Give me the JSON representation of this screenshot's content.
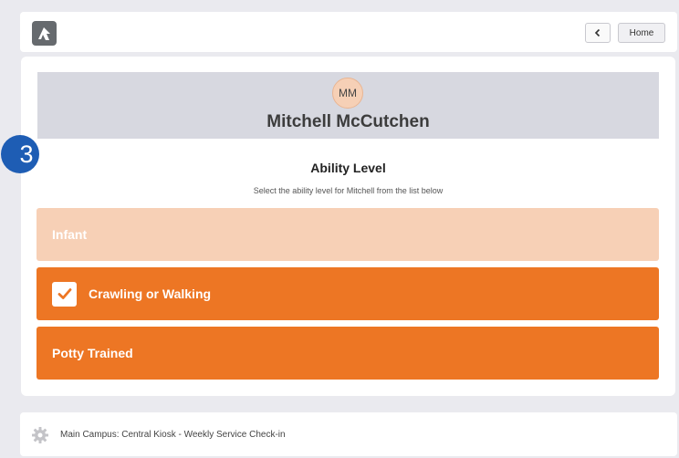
{
  "header": {
    "logo_icon": "rock-logo-icon",
    "back_icon": "chevron-left-icon",
    "home_label": "Home"
  },
  "person": {
    "initials": "MM",
    "name": "Mitchell McCutchen"
  },
  "step_badge": "3",
  "section": {
    "title": "Ability Level",
    "subtitle": "Select the ability level for Mitchell from the list below"
  },
  "options": [
    {
      "label": "Infant",
      "selected": false,
      "disabled": true
    },
    {
      "label": "Crawling or Walking",
      "selected": true,
      "disabled": false
    },
    {
      "label": "Potty Trained",
      "selected": false,
      "disabled": false
    }
  ],
  "footer": {
    "icon": "gear-icon",
    "text": "Main Campus: Central Kiosk - Weekly Service Check-in"
  },
  "colors": {
    "accent": "#ed7624",
    "accent_light": "#f7d0b6",
    "header_band": "#d7d8e0",
    "badge": "#1e5db4"
  }
}
